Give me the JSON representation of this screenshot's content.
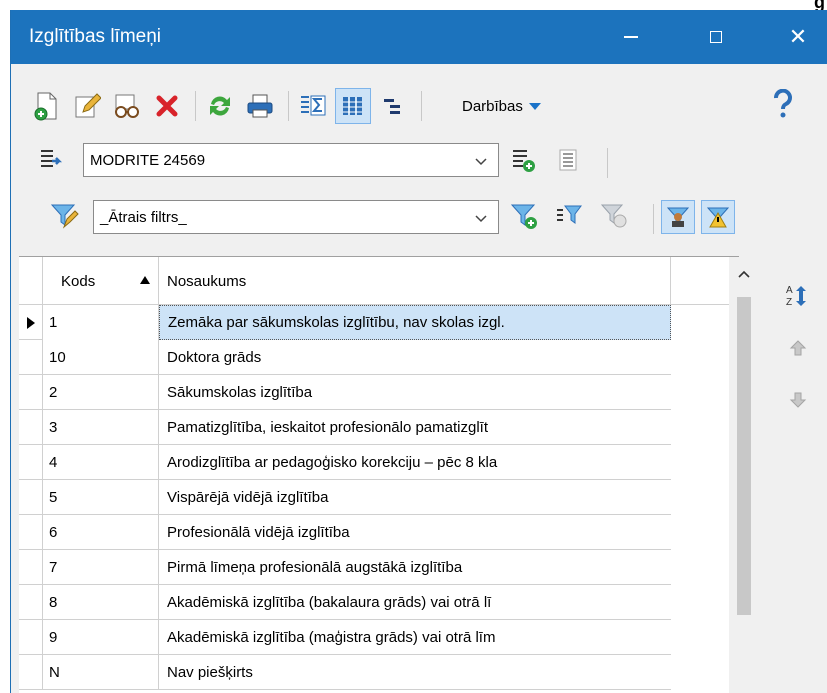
{
  "corner_text": "g",
  "window": {
    "title": "Izglītības līmeņi",
    "minimize_icon": "minimize-icon",
    "maximize_icon": "maximize-icon",
    "close_label": "✕"
  },
  "toolbar": {
    "actions_label": "Darbības",
    "icons": [
      "new-record-icon",
      "edit-icon",
      "view-icon",
      "delete-icon",
      "refresh-icon",
      "print-icon",
      "sum-icon",
      "columns-icon",
      "tree-icon",
      "help-icon"
    ]
  },
  "selector": {
    "value": "MODRITE 24569"
  },
  "filter": {
    "value": "_Ātrais filtrs_"
  },
  "grid": {
    "columns": {
      "code": "Kods",
      "name": "Nosaukums"
    },
    "rows": [
      {
        "code": "1",
        "name": "Zemāka par sākumskolas izglītību, nav skolas izgl."
      },
      {
        "code": "10",
        "name": "Doktora grāds"
      },
      {
        "code": "2",
        "name": "Sākumskolas izglītība"
      },
      {
        "code": "3",
        "name": "Pamatizglītība, ieskaitot profesionālo pamatizglīt"
      },
      {
        "code": "4",
        "name": "Arodizglītība ar pedagoģisko korekciju – pēc 8 kla"
      },
      {
        "code": "5",
        "name": "Vispārējā vidējā izglītība"
      },
      {
        "code": "6",
        "name": "Profesionālā vidējā izglītība"
      },
      {
        "code": "7",
        "name": "Pirmā līmeņa profesionālā augstākā izglītība"
      },
      {
        "code": "8",
        "name": "Akadēmiskā izglītība (bakalaura grāds) vai otrā lī"
      },
      {
        "code": "9",
        "name": "Akadēmiskā izglītība (maģistra grāds) vai otrā līm"
      },
      {
        "code": "N",
        "name": "Nav piešķirts"
      }
    ]
  },
  "colors": {
    "titlebar": "#1c73bd",
    "selection": "#cde3f7"
  }
}
